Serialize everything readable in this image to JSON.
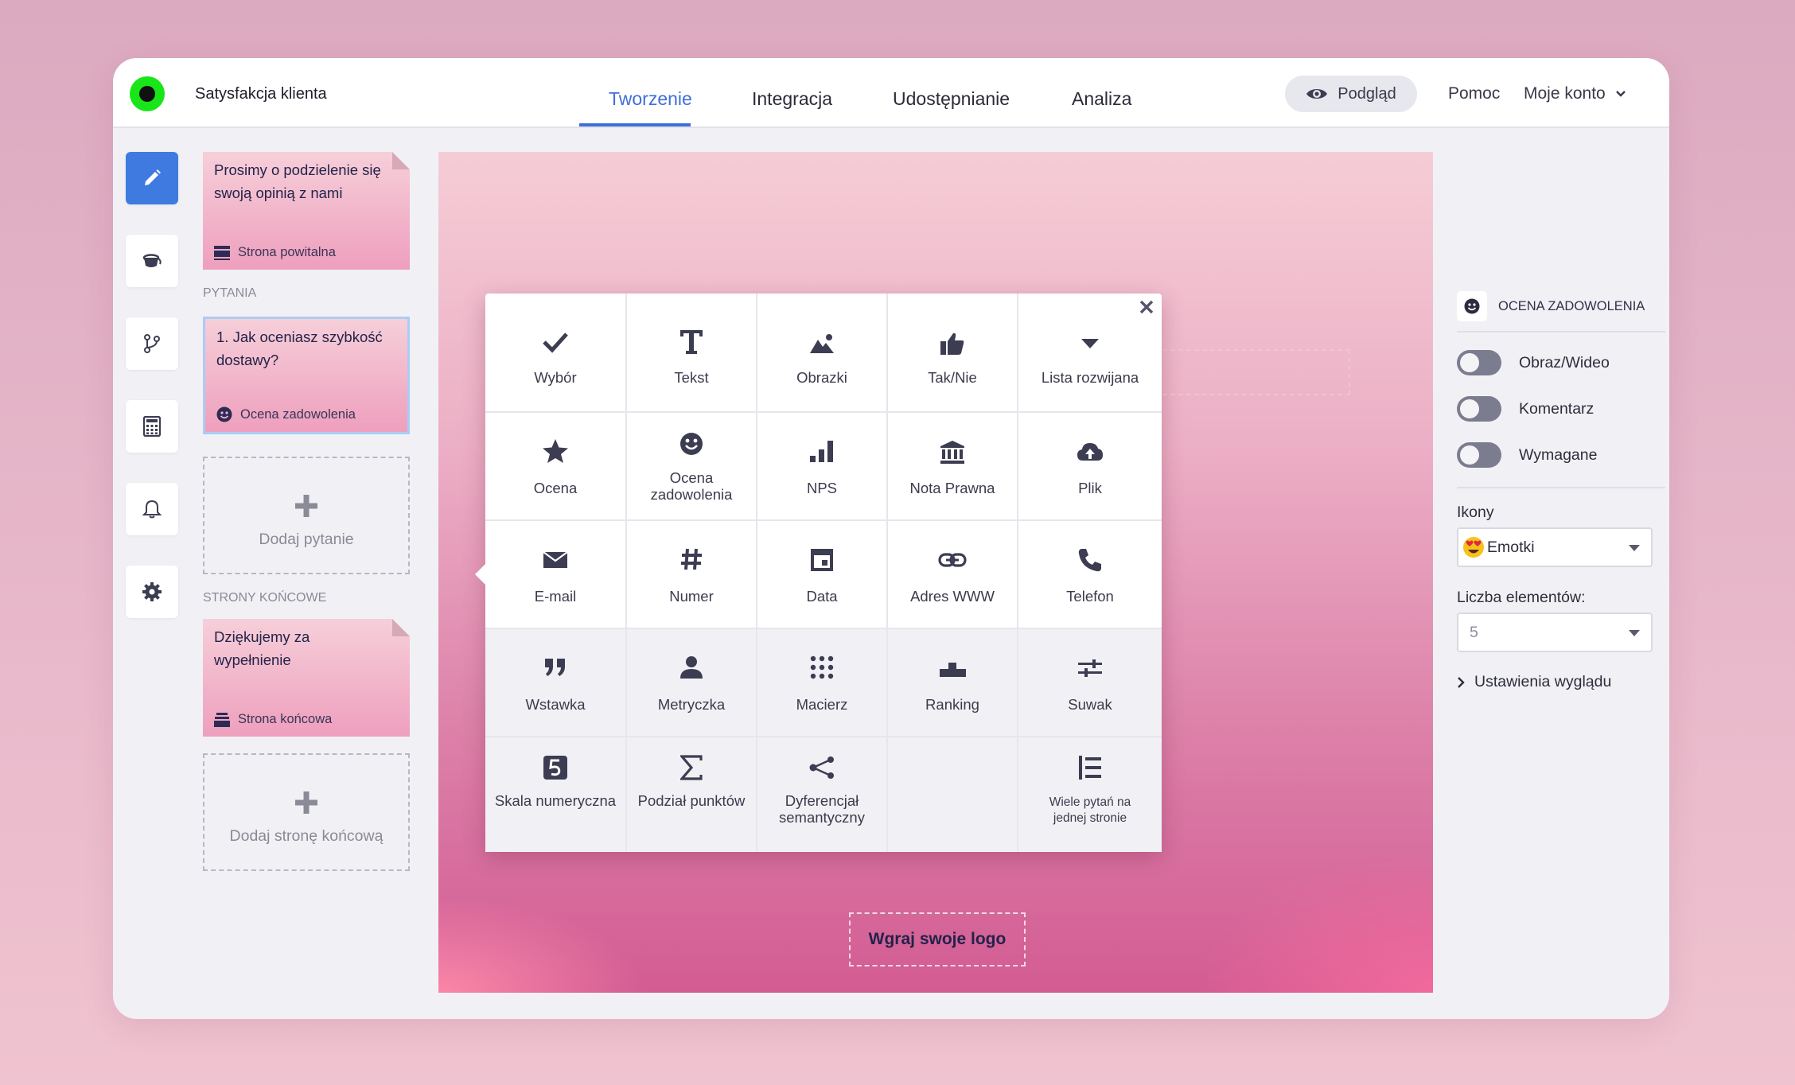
{
  "app": {
    "title": "Satysfakcja klienta"
  },
  "tabs": [
    {
      "label": "Tworzenie",
      "active": true
    },
    {
      "label": "Integracja"
    },
    {
      "label": "Udostępnianie"
    },
    {
      "label": "Analiza"
    }
  ],
  "header": {
    "preview_label": "Podgląd",
    "help_label": "Pomoc",
    "account_label": "Moje konto"
  },
  "left_nav": [
    "edit-icon",
    "theme-icon",
    "logic-icon",
    "calculator-icon",
    "bell-icon",
    "gear-icon"
  ],
  "pages": {
    "welcome": {
      "title": "Prosimy o podzielenie się swoją opinią z nami",
      "type": "Strona powitalna"
    },
    "questions_label": "PYTANIA",
    "question": {
      "title": "1. Jak oceniasz szybkość dostawy?",
      "type": "Ocena zadowolenia"
    },
    "add_question": "Dodaj pytanie",
    "endings_label": "STRONY KOŃCOWE",
    "ending": {
      "title": "Dziękujemy za wypełnienie",
      "type": "Strona końcowa"
    },
    "add_ending": "Dodaj stronę końcową"
  },
  "canvas": {
    "upload_logo": "Wgraj swoje logo"
  },
  "picker": {
    "items": [
      "Wybór",
      "Tekst",
      "Obrazki",
      "Tak/Nie",
      "Lista rozwijana",
      "Ocena",
      "Ocena zadowolenia",
      "NPS",
      "Nota Prawna",
      "Plik",
      "E-mail",
      "Numer",
      "Data",
      "Adres WWW",
      "Telefon",
      "Wstawka",
      "Metryczka",
      "Macierz",
      "Ranking",
      "Suwak",
      "Skala numeryczna",
      "Podział punktów",
      "Dyferencjał semantyczny",
      "",
      "Wiele pytań na jednej stronie"
    ]
  },
  "settings": {
    "title": "OCENA ZADOWOLENIA",
    "toggles": [
      "Obraz/Wideo",
      "Komentarz",
      "Wymagane"
    ],
    "icons_label": "Ikony",
    "icons_value": "Emotki",
    "count_label": "Liczba elementów:",
    "count_value": "5",
    "appearance_label": "Ustawienia wyglądu"
  },
  "colors": {
    "accent": "#3f6fd8",
    "nav_active": "#3f7ae0",
    "logo": "#19e619",
    "icon": "#3c3c52"
  }
}
